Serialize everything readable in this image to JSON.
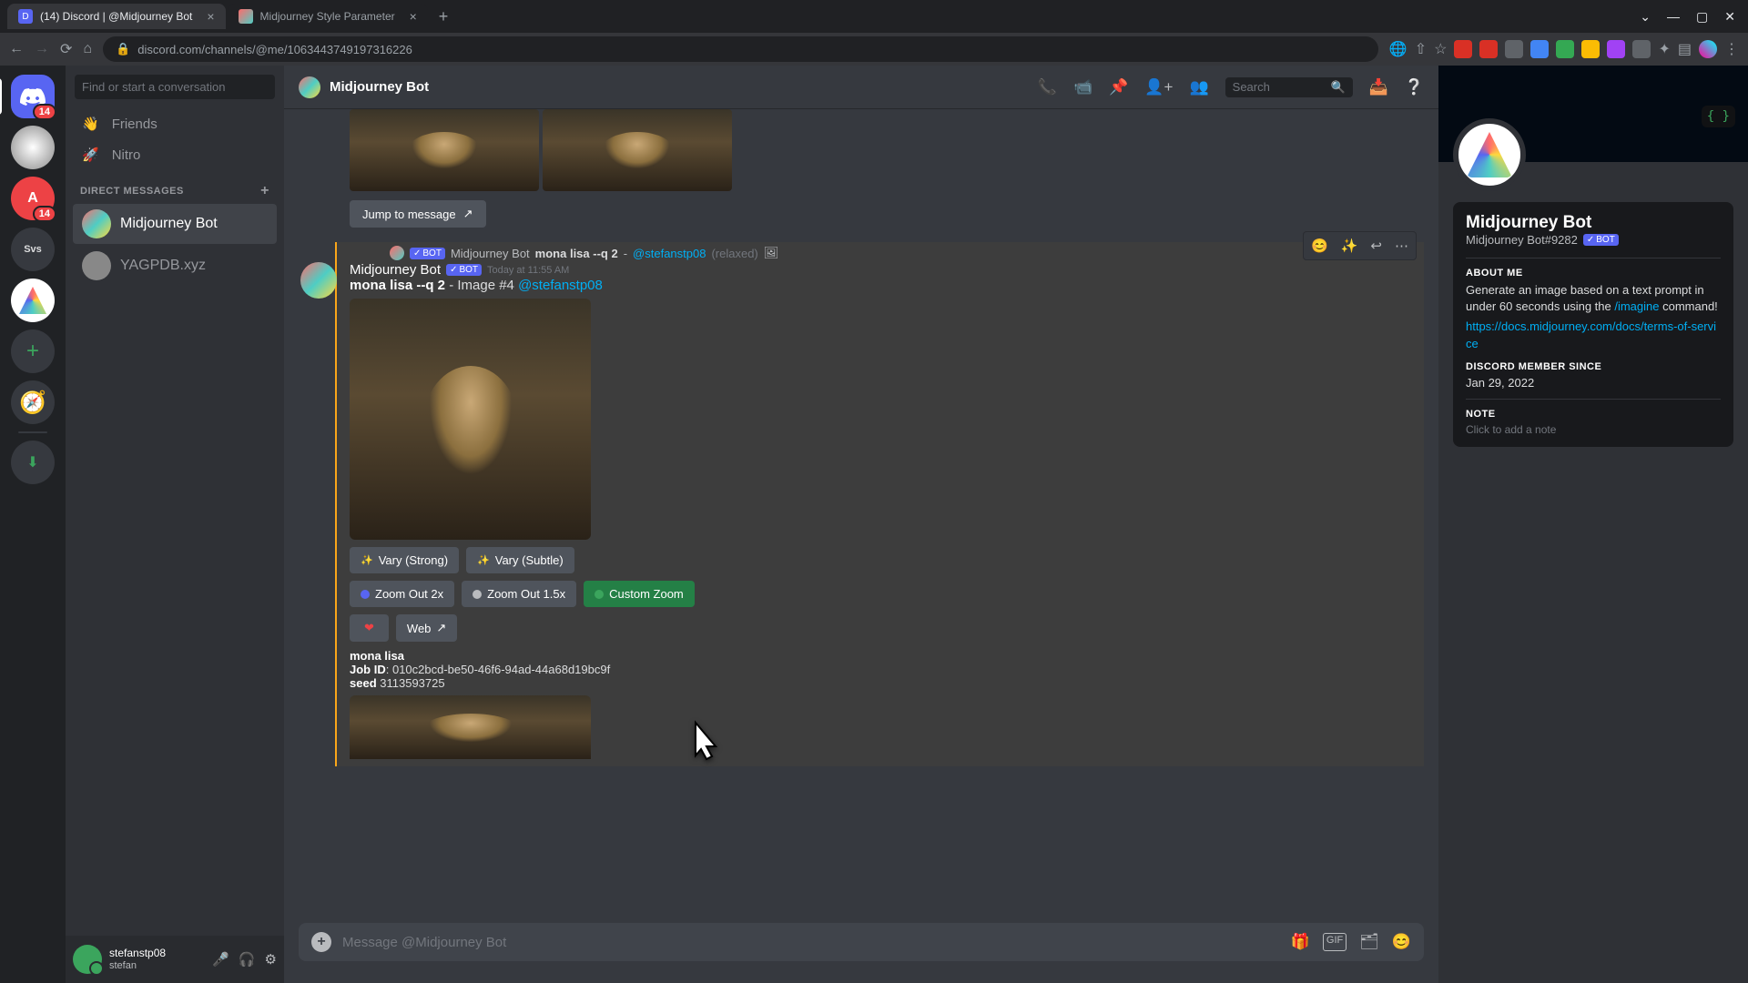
{
  "browser": {
    "tabs": [
      {
        "title": "(14) Discord | @Midjourney Bot",
        "active": true
      },
      {
        "title": "Midjourney Style Parameter",
        "active": false
      }
    ],
    "url": "discord.com/channels/@me/1063443749197316226",
    "window_controls": {
      "chevron": "⌄",
      "minimize": "—",
      "maximize": "▢",
      "close": "✕"
    }
  },
  "discord": {
    "servers": {
      "dm_badge": "14",
      "svs_label": "Svs"
    },
    "dm_sidebar": {
      "search_placeholder": "Find or start a conversation",
      "friends_label": "Friends",
      "nitro_label": "Nitro",
      "section_header": "DIRECT MESSAGES",
      "items": [
        {
          "name": "Midjourney Bot",
          "selected": true
        },
        {
          "name": "YAGPDB.xyz",
          "selected": false
        }
      ]
    },
    "user_panel": {
      "name": "stefanstp08",
      "tag": "stefan"
    },
    "header": {
      "title": "Midjourney Bot",
      "search_placeholder": "Search"
    },
    "chat": {
      "jump_label": "Jump to message",
      "reply": {
        "author": "Midjourney Bot",
        "bot_label": "BOT",
        "prompt_bold": "mona lisa --q 2",
        "mention": "@stefanstp08",
        "relaxed": "(relaxed)"
      },
      "message": {
        "author": "Midjourney Bot",
        "bot_label": "BOT",
        "timestamp": "Today at 11:55 AM",
        "text_bold": "mona lisa --q 2",
        "text_mid": " - Image #4 ",
        "mention": "@stefanstp08"
      },
      "buttons": {
        "vary_strong": "Vary (Strong)",
        "vary_subtle": "Vary (Subtle)",
        "zoom_2x": "Zoom Out 2x",
        "zoom_15x": "Zoom Out 1.5x",
        "custom_zoom": "Custom Zoom",
        "heart": "❤",
        "web": "Web"
      },
      "meta": {
        "title": "mona lisa",
        "job_label": "Job ID",
        "job_value": "010c2bcd-be50-46f6-94ad-44a68d19bc9f",
        "seed_label": "seed",
        "seed_value": "3113593725"
      },
      "input_placeholder": "Message @Midjourney Bot"
    },
    "profile": {
      "name": "Midjourney Bot",
      "tag": "Midjourney Bot#9282",
      "bot_label": "BOT",
      "badge_text": "{ }",
      "about_header": "ABOUT ME",
      "about_text_1": "Generate an image based on a text prompt in under 60 seconds using the ",
      "about_cmd": "/imagine",
      "about_text_2": " command!",
      "about_link": "https://docs.midjourney.com/docs/terms-of-service",
      "member_header": "DISCORD MEMBER SINCE",
      "member_date": "Jan 29, 2022",
      "note_header": "NOTE",
      "note_placeholder": "Click to add a note"
    }
  }
}
